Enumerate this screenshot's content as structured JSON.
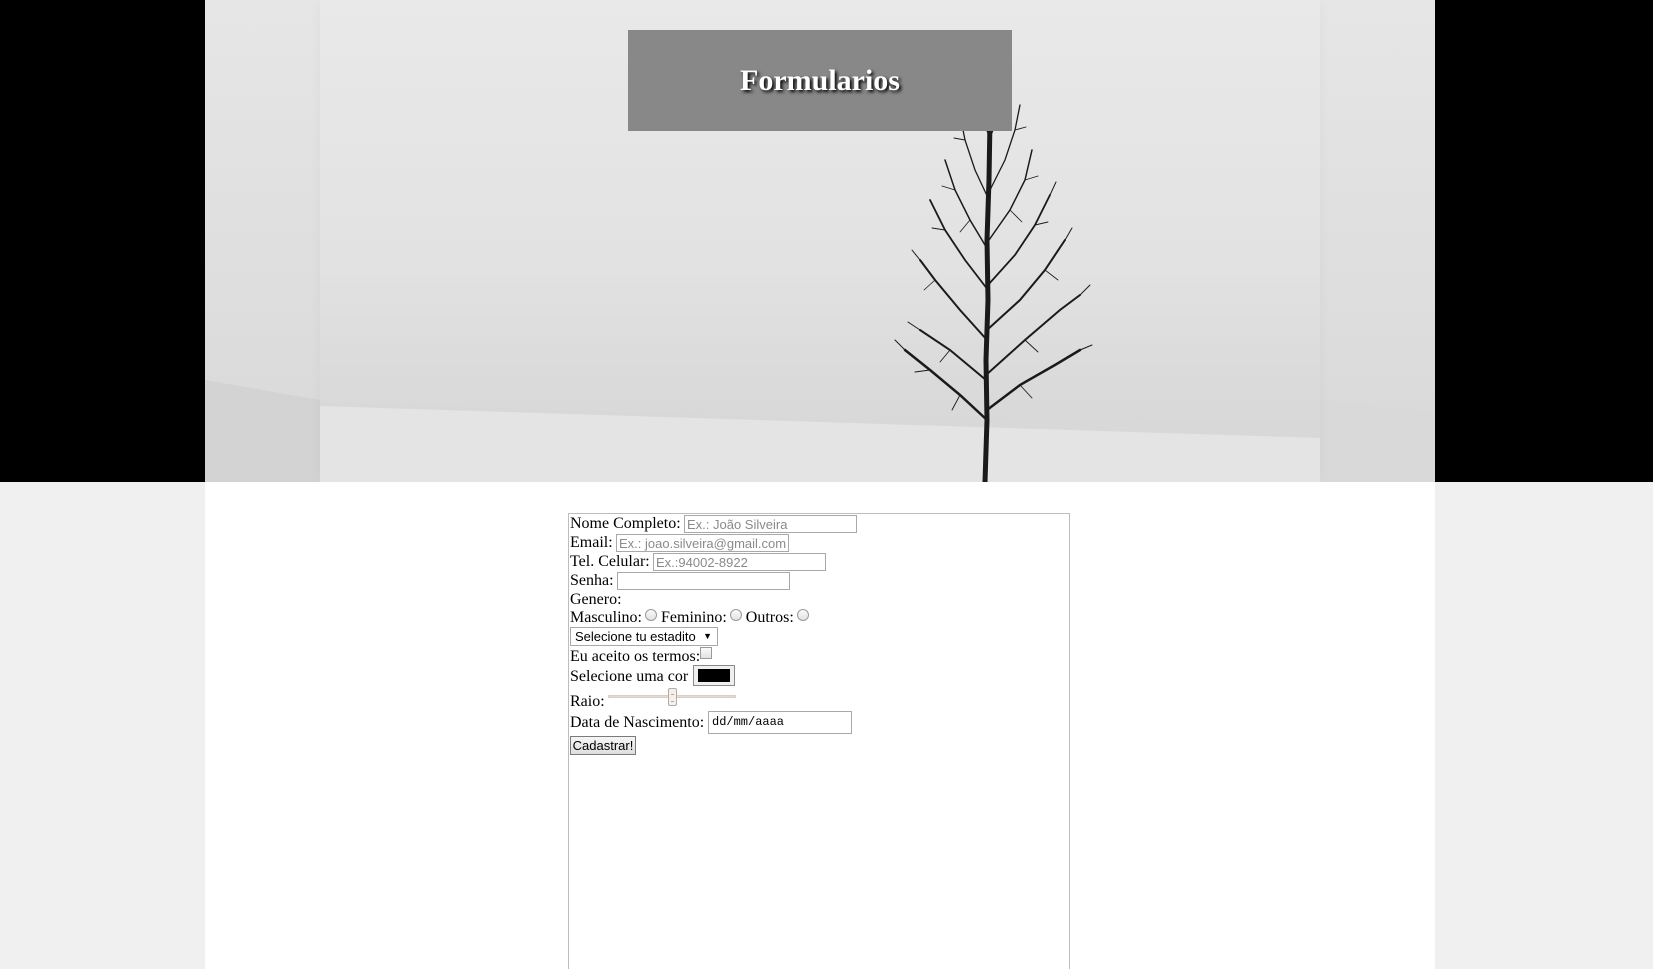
{
  "header": {
    "title": "Formularios"
  },
  "form": {
    "full_name": {
      "label": "Nome Completo:",
      "placeholder": "Ex.: João Silveira",
      "value": ""
    },
    "email": {
      "label": "Email:",
      "placeholder": "Ex.: joao.silveira@gmail.com",
      "value": ""
    },
    "phone": {
      "label": "Tel. Celular:",
      "placeholder": "Ex.:94002-8922",
      "value": ""
    },
    "password": {
      "label": "Senha:",
      "value": ""
    },
    "gender": {
      "label": "Genero:",
      "options": [
        "Masculino:",
        "Feminino:",
        "Outros:"
      ],
      "selected": null
    },
    "stadium_select": {
      "selected": "Selecione tu estadito"
    },
    "terms": {
      "label": "Eu aceito os termos:",
      "checked": false
    },
    "color": {
      "label": "Selecione uma cor",
      "value": "#000000"
    },
    "radius": {
      "label": "Raio:",
      "value_fraction": 0.5
    },
    "birth_date": {
      "label": "Data de Nascimento:",
      "placeholder": "dd/mm/aaaa"
    },
    "submit_label": "Cadastrar!"
  },
  "colors": {
    "outer_background": "#000000",
    "page_background": "#f0f0f0",
    "title_box": "#888888",
    "form_background": "#ffffff"
  },
  "icons": {
    "select_arrow": "chevron-down-icon"
  }
}
